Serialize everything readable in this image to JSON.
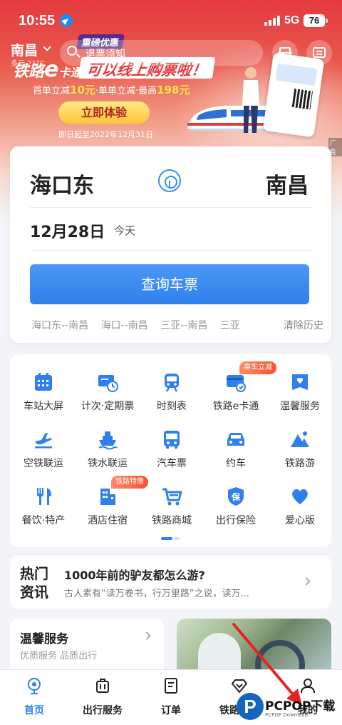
{
  "status_bar": {
    "time": "10:55",
    "network": "5G",
    "battery": "76"
  },
  "header": {
    "city": "南昌",
    "weather": "多云 21°C",
    "search_placeholder": "退票须知"
  },
  "banner": {
    "tag": "重磅优惠",
    "logo_text": "铁路",
    "logo_e": "e",
    "logo_suffix": "卡通",
    "headline": "可以线上购票啦！",
    "subline_a": "首单立减",
    "subline_a_val": "10元",
    "subline_b": "·单单立减·最高",
    "subline_b_val": "198元",
    "cta": "立即体验",
    "date_range": "即日起至2022年12月31日",
    "ad_label": "广告"
  },
  "booking": {
    "from": "海口东",
    "to": "南昌",
    "date": "12月28日",
    "weekday": "今天",
    "query_button": "查询车票",
    "history": [
      "海口东--南昌",
      "海口--南昌",
      "三亚--南昌",
      "三亚"
    ],
    "clear_history": "清除历史"
  },
  "services": {
    "items": [
      {
        "label": "车站大屏",
        "icon": "calendar-icon"
      },
      {
        "label": "计次·定期票",
        "icon": "ticket-clock-icon"
      },
      {
        "label": "时刻表",
        "icon": "train-icon"
      },
      {
        "label": "铁路e卡通",
        "icon": "card-icon",
        "badge": "乘车立减"
      },
      {
        "label": "温馨服务",
        "icon": "heart-box-icon"
      },
      {
        "label": "空铁联运",
        "icon": "plane-icon"
      },
      {
        "label": "铁水联运",
        "icon": "ship-icon"
      },
      {
        "label": "汽车票",
        "icon": "bus-icon"
      },
      {
        "label": "约车",
        "icon": "car-icon"
      },
      {
        "label": "铁路游",
        "icon": "mountain-icon"
      },
      {
        "label": "餐饮·特产",
        "icon": "dining-icon"
      },
      {
        "label": "酒店住宿",
        "icon": "hotel-icon",
        "badge": "铁路特惠"
      },
      {
        "label": "铁路商城",
        "icon": "cart-icon"
      },
      {
        "label": "出行保险",
        "icon": "shield-icon"
      },
      {
        "label": "爱心版",
        "icon": "heart-icon"
      }
    ]
  },
  "news": {
    "tag_line1": "热门",
    "tag_line2": "资讯",
    "title": "1000年前的驴友都怎么游?",
    "desc": "古人素有“读万卷书，行万里路”之说，读万..."
  },
  "warm_service": {
    "title": "温馨服务",
    "subtitle": "优质服务 品质出行"
  },
  "tabbar": {
    "tabs": [
      {
        "label": "首页",
        "icon": "home-icon",
        "active": true
      },
      {
        "label": "出行服务",
        "icon": "luggage-icon",
        "active": false
      },
      {
        "label": "订单",
        "icon": "order-icon",
        "active": false
      },
      {
        "label": "铁路会员",
        "icon": "diamond-icon",
        "active": false
      },
      {
        "label": "我的",
        "icon": "user-icon",
        "active": false
      }
    ]
  },
  "watermark": {
    "logo": "P",
    "text": "PCPOP下载",
    "sub": "PCPOP Download"
  },
  "colors": {
    "primary": "#2f80ed",
    "banner_red": "#e4393f",
    "badge_orange": "#f5532f",
    "annotation_red": "#e8231f"
  }
}
